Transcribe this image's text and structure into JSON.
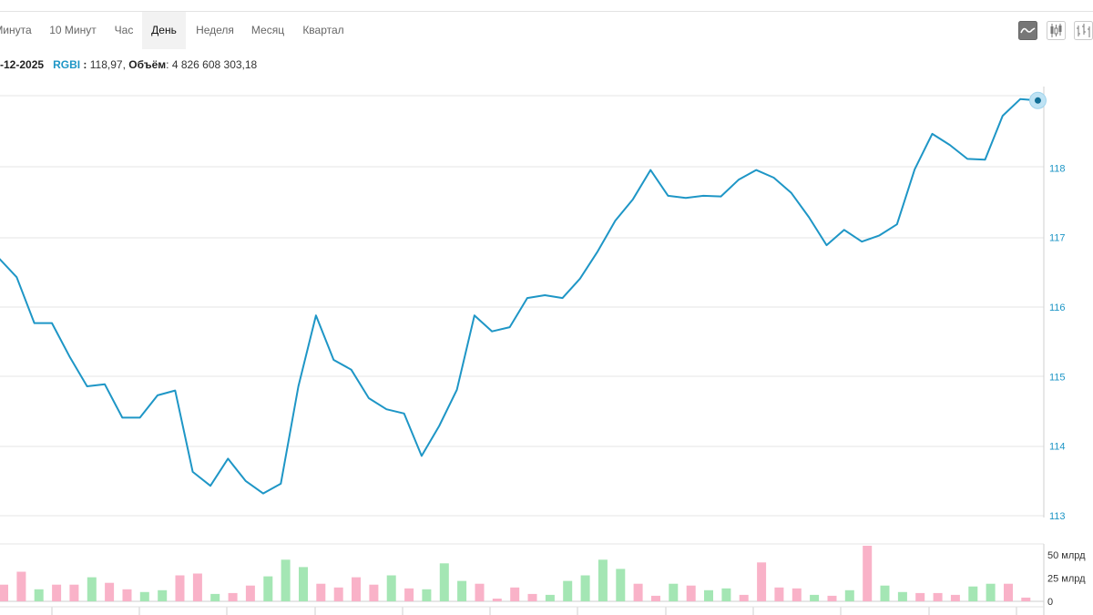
{
  "tabs": [
    {
      "label": "Минута",
      "active": false
    },
    {
      "label": "10 Минут",
      "active": false
    },
    {
      "label": "Час",
      "active": false
    },
    {
      "label": "День",
      "active": true
    },
    {
      "label": "Неделя",
      "active": false
    },
    {
      "label": "Месяц",
      "active": false
    },
    {
      "label": "Квартал",
      "active": false
    }
  ],
  "chart_types": [
    {
      "icon": "line-chart-icon",
      "active": true
    },
    {
      "icon": "candlestick-chart-icon",
      "active": false
    },
    {
      "icon": "ohlc-chart-icon",
      "active": false
    }
  ],
  "info": {
    "date": "-12-2025",
    "ticker": "RGBI",
    "price_sep": ":",
    "price": "118,97,",
    "volume_label": "Объём",
    "volume": "4 826 608 303,18"
  },
  "colors": {
    "line": "#1e96c6",
    "volume_up": "#a4e6b4",
    "volume_down": "#f9b2c8",
    "grid": "#e6e6e6"
  },
  "chart_data": [
    {
      "type": "line",
      "title": "",
      "series": [
        {
          "values": [
            116.7,
            116.43,
            115.77,
            115.77,
            115.29,
            114.86,
            114.89,
            114.41,
            114.41,
            114.73,
            114.8,
            113.63,
            113.43,
            113.82,
            113.5,
            113.32,
            113.46,
            114.86,
            115.88,
            115.24,
            115.1,
            114.69,
            114.53,
            114.47,
            113.86,
            114.29,
            114.81,
            115.88,
            115.65,
            115.71,
            116.13,
            116.17,
            116.13,
            116.41,
            116.8,
            117.24,
            117.55,
            117.97,
            117.6,
            117.57,
            117.6,
            117.59,
            117.83,
            117.97,
            117.86,
            117.64,
            117.29,
            116.89,
            117.11,
            116.94,
            117.03,
            117.19,
            117.98,
            118.49,
            118.33,
            118.13,
            118.12,
            118.75,
            118.99,
            118.97
          ]
        }
      ],
      "y_ticks": [
        "113",
        "114",
        "115",
        "116",
        "117",
        "118"
      ],
      "ylim": [
        113,
        119
      ]
    },
    {
      "type": "bar",
      "title": "",
      "series": [
        {
          "values": [
            18,
            32,
            13,
            18,
            18,
            26,
            20,
            13,
            10,
            12,
            28,
            30,
            8,
            9,
            17,
            27,
            45,
            37,
            19,
            15,
            26,
            18,
            28,
            14,
            13,
            41,
            22,
            19,
            3,
            15,
            8,
            7,
            22,
            28,
            45,
            35,
            19,
            6,
            19,
            17,
            12,
            14,
            7,
            42,
            15,
            14,
            7,
            6,
            12,
            60,
            17,
            10,
            9,
            9,
            7,
            16,
            19,
            19,
            4
          ],
          "direction": [
            "d",
            "d",
            "u",
            "d",
            "d",
            "u",
            "d",
            "d",
            "u",
            "u",
            "d",
            "d",
            "u",
            "d",
            "d",
            "u",
            "u",
            "u",
            "d",
            "d",
            "d",
            "d",
            "u",
            "d",
            "u",
            "u",
            "u",
            "d",
            "d",
            "d",
            "d",
            "u",
            "u",
            "u",
            "u",
            "u",
            "d",
            "d",
            "u",
            "d",
            "u",
            "u",
            "d",
            "d",
            "d",
            "d",
            "u",
            "d",
            "u",
            "d",
            "u",
            "u",
            "d",
            "d",
            "d",
            "u",
            "u",
            "d",
            "d"
          ]
        }
      ],
      "y_ticks": [
        "0",
        "25 млрд",
        "50 млрд"
      ],
      "ylim": [
        0,
        62
      ]
    }
  ]
}
